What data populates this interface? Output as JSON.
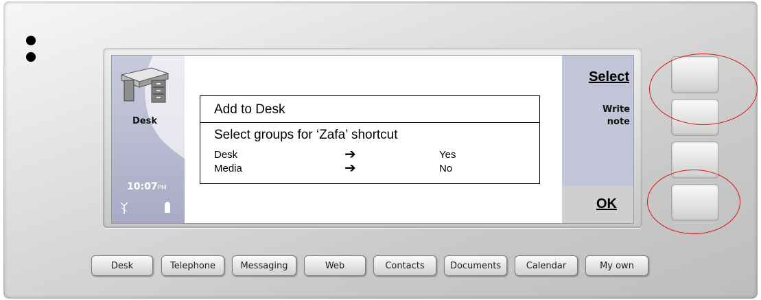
{
  "left_pane": {
    "app_name": "Desk",
    "clock_time": "10:07",
    "clock_ampm": "PM",
    "icon": "desk-icon"
  },
  "dialog": {
    "title": "Add to Desk",
    "prompt": "Select groups for ‘Zafa’ shortcut",
    "rows": [
      {
        "name": "Desk",
        "value": "Yes"
      },
      {
        "name": "Media",
        "value": "No"
      }
    ],
    "arrow_glyph": "➔"
  },
  "softkeys": {
    "select": "Select",
    "write_note_line1": "Write",
    "write_note_line2": "note",
    "ok": "OK"
  },
  "app_buttons": [
    "Desk",
    "Telephone",
    "Messaging",
    "Web",
    "Contacts",
    "Documents",
    "Calendar",
    "My own"
  ],
  "colors": {
    "highlight_ring": "#dd1111",
    "side_pane": "#c4c4d9"
  }
}
